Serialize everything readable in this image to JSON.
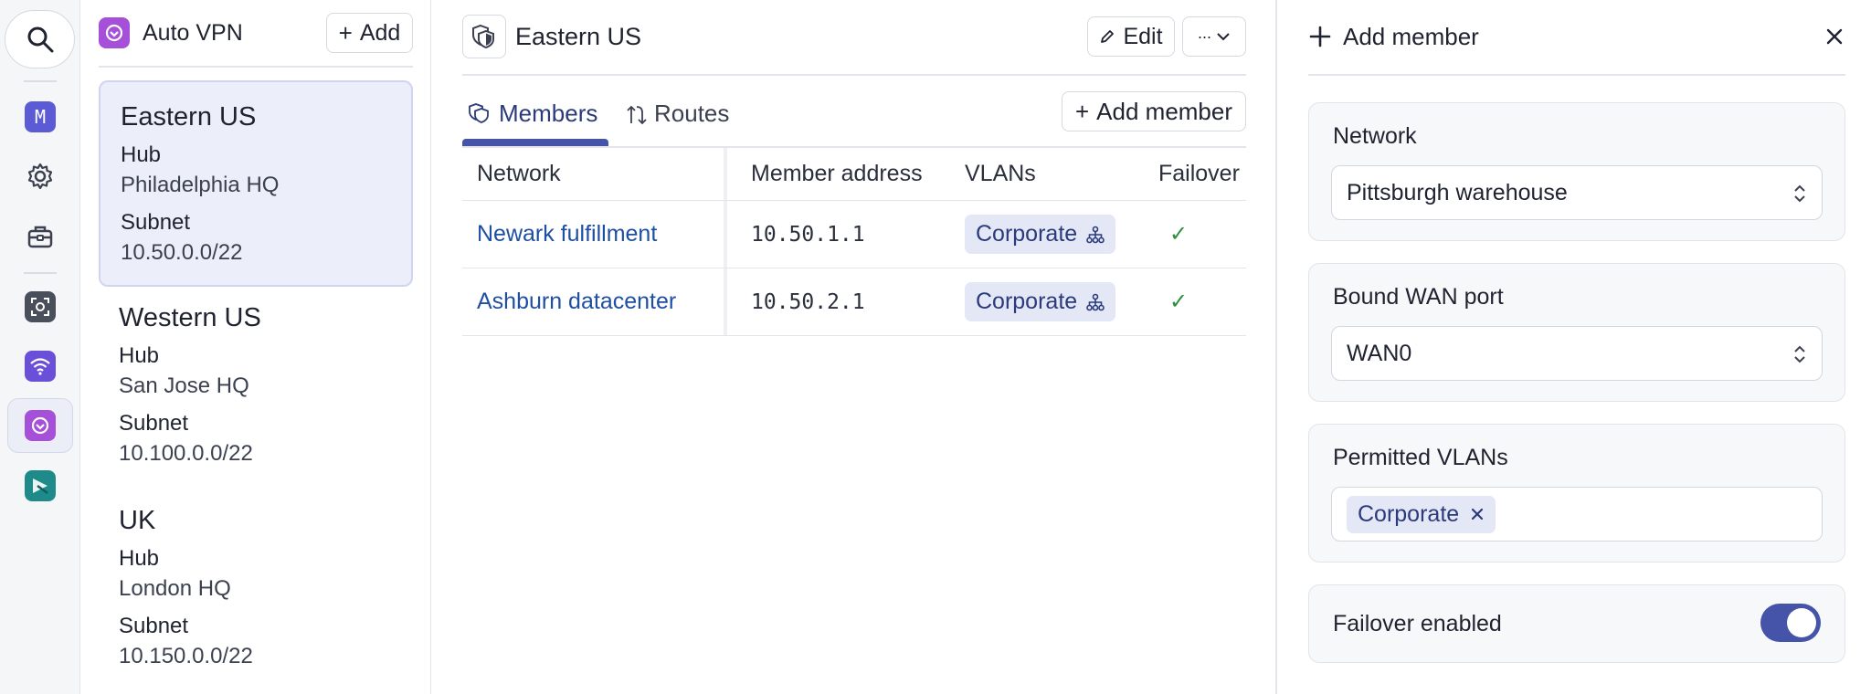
{
  "app": {
    "title": "Auto VPN",
    "add_label": "Add"
  },
  "rail": {
    "items": [
      {
        "icon": "search-icon"
      },
      {
        "icon": "m-app-icon",
        "letter": "M",
        "color": "#5b5bd6"
      },
      {
        "icon": "gear-icon"
      },
      {
        "icon": "toolbox-icon"
      },
      {
        "icon": "screen-capture-icon",
        "color": "#4a4f5c"
      },
      {
        "icon": "wifi-icon",
        "color": "#6a4fd8"
      },
      {
        "icon": "auto-vpn-icon",
        "color": "#a64fd8"
      },
      {
        "icon": "router-icon",
        "color": "#1f8a8a"
      }
    ]
  },
  "vpns": [
    {
      "name": "Eastern US",
      "hub_label": "Hub",
      "hub": "Philadelphia HQ",
      "subnet_label": "Subnet",
      "subnet": "10.50.0.0/22",
      "selected": true
    },
    {
      "name": "Western US",
      "hub_label": "Hub",
      "hub": "San Jose HQ",
      "subnet_label": "Subnet",
      "subnet": "10.100.0.0/22",
      "selected": false
    },
    {
      "name": "UK",
      "hub_label": "Hub",
      "hub": "London HQ",
      "subnet_label": "Subnet",
      "subnet": "10.150.0.0/22",
      "selected": false
    }
  ],
  "main": {
    "title": "Eastern US",
    "edit_label": "Edit",
    "more_label": "···",
    "tabs": [
      {
        "label": "Members",
        "active": true
      },
      {
        "label": "Routes",
        "active": false
      }
    ],
    "add_member_label": "Add member",
    "table": {
      "columns": [
        "Network",
        "Member address",
        "VLANs",
        "Failover"
      ],
      "rows": [
        {
          "network": "Newark fulfillment",
          "address": "10.50.1.1",
          "vlan": "Corporate",
          "failover": "✓"
        },
        {
          "network": "Ashburn datacenter",
          "address": "10.50.2.1",
          "vlan": "Corporate",
          "failover": "✓"
        }
      ]
    }
  },
  "panel": {
    "title": "Add member",
    "network": {
      "label": "Network",
      "value": "Pittsburgh warehouse"
    },
    "wan": {
      "label": "Bound WAN port",
      "value": "WAN0"
    },
    "vlans": {
      "label": "Permitted VLANs",
      "tags": [
        "Corporate"
      ]
    },
    "failover": {
      "label": "Failover enabled",
      "on": true
    }
  },
  "colors": {
    "accent": "#4553a8",
    "link": "#1f4fa3",
    "pill_bg": "#e4e8f6",
    "check": "#2f8f3a"
  }
}
